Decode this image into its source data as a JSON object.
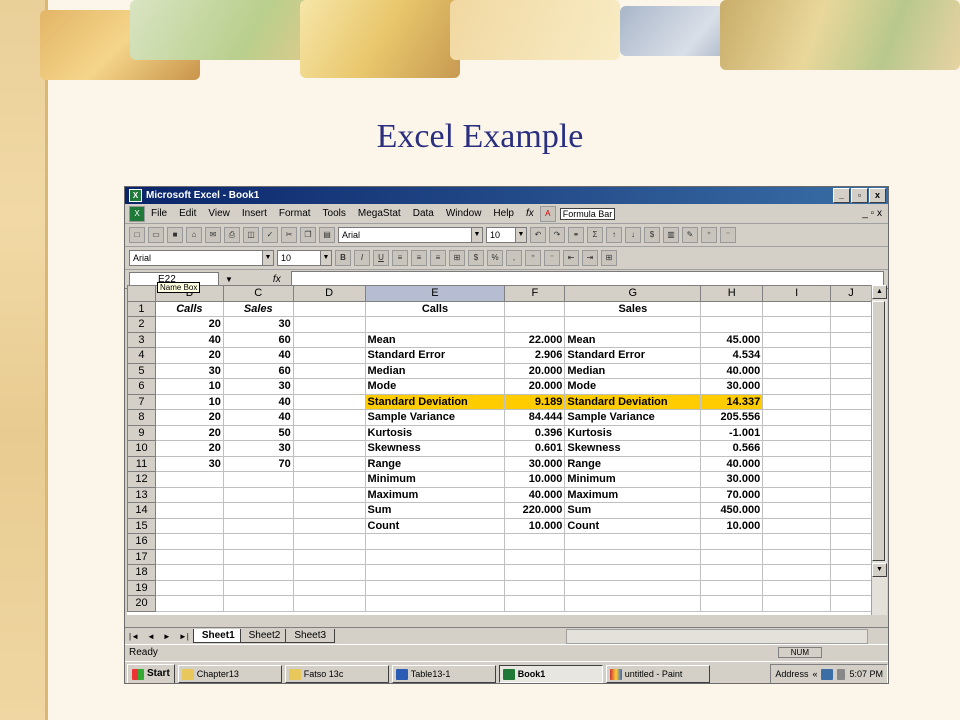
{
  "slide": {
    "title": "Excel Example"
  },
  "window": {
    "title": "Microsoft Excel - Book1",
    "controls": {
      "minimize": "_",
      "restore": "▫",
      "close": "x"
    }
  },
  "menu": [
    "File",
    "Edit",
    "View",
    "Insert",
    "Format",
    "Tools",
    "MegaStat",
    "Data",
    "Window",
    "Help"
  ],
  "menu_fx": "fx",
  "formula_bar_button": "Formula Bar",
  "toolbar": {
    "font": "Arial",
    "size": "10"
  },
  "format_toolbar": {
    "font": "Arial",
    "size": "10",
    "bold": "B",
    "italic": "I",
    "underline": "U",
    "currency": "$",
    "percent": "%",
    "comma": ","
  },
  "formula": {
    "name_box": "E22",
    "fx": "fx",
    "tooltip": "Name Box"
  },
  "columns": [
    "",
    "B",
    "C",
    "D",
    "E",
    "F",
    "G",
    "H",
    "I",
    "J"
  ],
  "rows": [
    [
      "1",
      "Calls",
      "Sales",
      "",
      "Calls",
      "",
      "Sales",
      "",
      "",
      ""
    ],
    [
      "2",
      "20",
      "30",
      "",
      "",
      "",
      "",
      "",
      "",
      ""
    ],
    [
      "3",
      "40",
      "60",
      "",
      "Mean",
      "22.000",
      "Mean",
      "45.000",
      "",
      ""
    ],
    [
      "4",
      "20",
      "40",
      "",
      "Standard Error",
      "2.906",
      "Standard Error",
      "4.534",
      "",
      ""
    ],
    [
      "5",
      "30",
      "60",
      "",
      "Median",
      "20.000",
      "Median",
      "40.000",
      "",
      ""
    ],
    [
      "6",
      "10",
      "30",
      "",
      "Mode",
      "20.000",
      "Mode",
      "30.000",
      "",
      ""
    ],
    [
      "7",
      "10",
      "40",
      "",
      "Standard Deviation",
      "9.189",
      "Standard Deviation",
      "14.337",
      "",
      ""
    ],
    [
      "8",
      "20",
      "40",
      "",
      "Sample Variance",
      "84.444",
      "Sample Variance",
      "205.556",
      "",
      ""
    ],
    [
      "9",
      "20",
      "50",
      "",
      "Kurtosis",
      "0.396",
      "Kurtosis",
      "-1.001",
      "",
      ""
    ],
    [
      "10",
      "20",
      "30",
      "",
      "Skewness",
      "0.601",
      "Skewness",
      "0.566",
      "",
      ""
    ],
    [
      "11",
      "30",
      "70",
      "",
      "Range",
      "30.000",
      "Range",
      "40.000",
      "",
      ""
    ],
    [
      "12",
      "",
      "",
      "",
      "Minimum",
      "10.000",
      "Minimum",
      "30.000",
      "",
      ""
    ],
    [
      "13",
      "",
      "",
      "",
      "Maximum",
      "40.000",
      "Maximum",
      "70.000",
      "",
      ""
    ],
    [
      "14",
      "",
      "",
      "",
      "Sum",
      "220.000",
      "Sum",
      "450.000",
      "",
      ""
    ],
    [
      "15",
      "",
      "",
      "",
      "Count",
      "10.000",
      "Count",
      "10.000",
      "",
      ""
    ],
    [
      "16",
      "",
      "",
      "",
      "",
      "",
      "",
      "",
      "",
      ""
    ],
    [
      "17",
      "",
      "",
      "",
      "",
      "",
      "",
      "",
      "",
      ""
    ],
    [
      "18",
      "",
      "",
      "",
      "",
      "",
      "",
      "",
      "",
      ""
    ],
    [
      "19",
      "",
      "",
      "",
      "",
      "",
      "",
      "",
      "",
      ""
    ],
    [
      "20",
      "",
      "",
      "",
      "",
      "",
      "",
      "",
      "",
      ""
    ]
  ],
  "highlight_row": 7,
  "highlight_color": "#ffcc00",
  "sheets": [
    "Sheet1",
    "Sheet2",
    "Sheet3"
  ],
  "active_sheet": "Sheet1",
  "status": {
    "ready": "Ready",
    "num": "NUM"
  },
  "taskbar": {
    "start": "Start",
    "items": [
      "Chapter13",
      "Fatso 13c",
      "Table13-1",
      "Book1",
      "untitled - Paint"
    ],
    "active_item": "Book1",
    "address": "Address",
    "address_arrows": "«",
    "time": "5:07 PM"
  }
}
